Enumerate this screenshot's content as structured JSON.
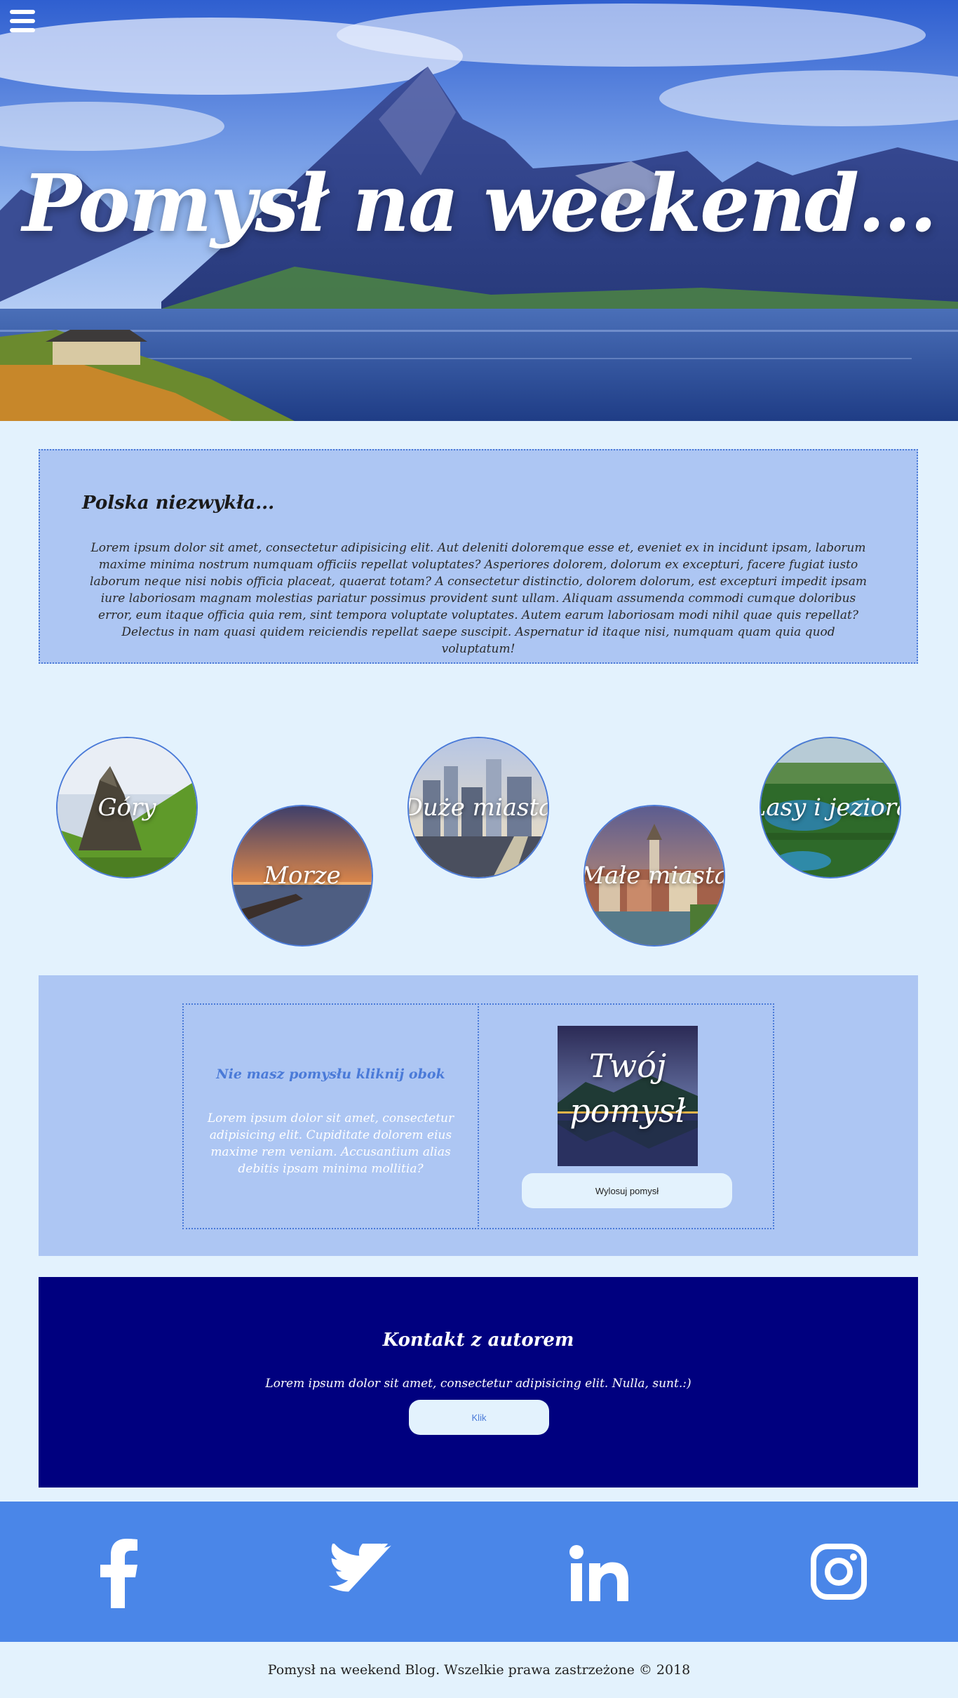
{
  "hero": {
    "title": "Pomysł na weekend..."
  },
  "intro": {
    "heading": "Polska niezwykła...",
    "text": "Lorem ipsum dolor sit amet, consectetur adipisicing elit. Aut deleniti doloremque esse et, eveniet ex in incidunt ipsam, laborum maxime minima nostrum numquam officiis repellat voluptates? Asperiores dolorem, dolorum ex excepturi, facere fugiat iusto laborum neque nisi nobis officia placeat, quaerat totam? A consectetur distinctio, dolorem dolorum, est excepturi impedit ipsam iure laboriosam magnam molestias pariatur possimus provident sunt ullam. Aliquam assumenda commodi cumque doloribus error, eum itaque officia quia rem, sint tempora voluptate voluptates. Autem earum laboriosam modi nihil quae quis repellat? Delectus in nam quasi quidem reiciendis repellat saepe suscipit. Aspernatur id itaque nisi, numquam quam quia quod voluptatum!"
  },
  "categories": [
    {
      "label": "Góry"
    },
    {
      "label": "Morze"
    },
    {
      "label": "Duże miasta"
    },
    {
      "label": "Małe miasta"
    },
    {
      "label": "Lasy i jeziora"
    }
  ],
  "idea": {
    "heading": "Nie masz pomysłu kliknij obok",
    "text": "Lorem ipsum dolor sit amet, consectetur adipisicing elit. Cupiditate dolorem eius maxime rem veniam. Accusantium alias debitis ipsam minima mollitia?",
    "image_label": "Twój pomysł",
    "button_label": "Wylosuj pomysł"
  },
  "contact": {
    "heading": "Kontakt z autorem",
    "text": "Lorem ipsum dolor sit amet, consectetur adipisicing elit. Nulla, sunt.:)",
    "button_label": "Klik"
  },
  "social": {
    "icons": [
      "facebook-icon",
      "twitter-icon",
      "linkedin-icon",
      "instagram-icon"
    ]
  },
  "footer": {
    "text": "Pomysł na weekend Blog. Wszelkie prawa zastrzeżone © 2018"
  },
  "colors": {
    "page_bg": "#e3f2fd",
    "panel": "#adc6f3",
    "accent": "#4a7ad8",
    "contact_bg": "#00007f",
    "social_bg": "#4a86e8"
  }
}
